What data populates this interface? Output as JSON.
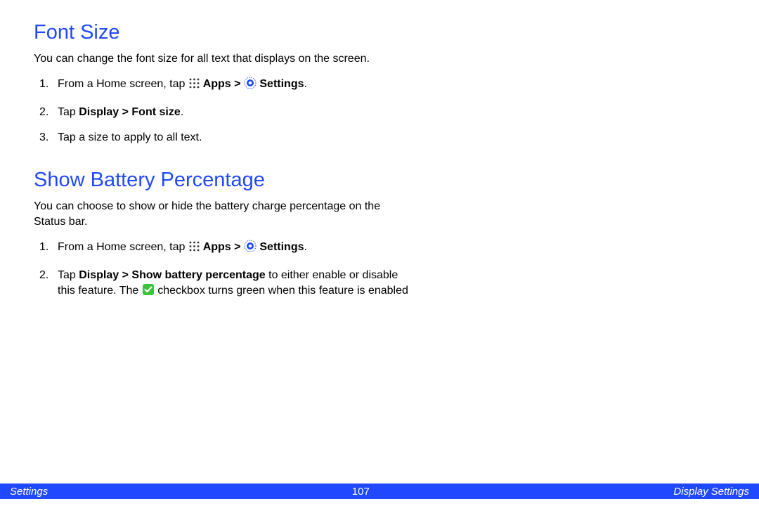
{
  "section1": {
    "heading": "Font Size",
    "intro": "You can change the font size for all text that displays on the screen.",
    "steps": {
      "s1a": "From a Home screen, tap ",
      "s1b": " Apps > ",
      "s1c": " Settings",
      "s1d": ".",
      "s2a": "Tap ",
      "s2b": "Display > Font size",
      "s2c": ".",
      "s3": "Tap a size to apply to all text."
    }
  },
  "section2": {
    "heading": "Show Battery Percentage",
    "intro": "You can choose to show or hide the battery charge percentage on the Status bar.",
    "steps": {
      "s1a": "From a Home screen, tap ",
      "s1b": " Apps > ",
      "s1c": " Settings",
      "s1d": ".",
      "s2a": "Tap ",
      "s2b": "Display > Show battery percentage",
      "s2c": " to either enable or disable this feature. The ",
      "s2d": " checkbox turns green when this feature is enabled"
    }
  },
  "footer": {
    "left": "Settings",
    "center": "107",
    "right": "Display Settings"
  }
}
